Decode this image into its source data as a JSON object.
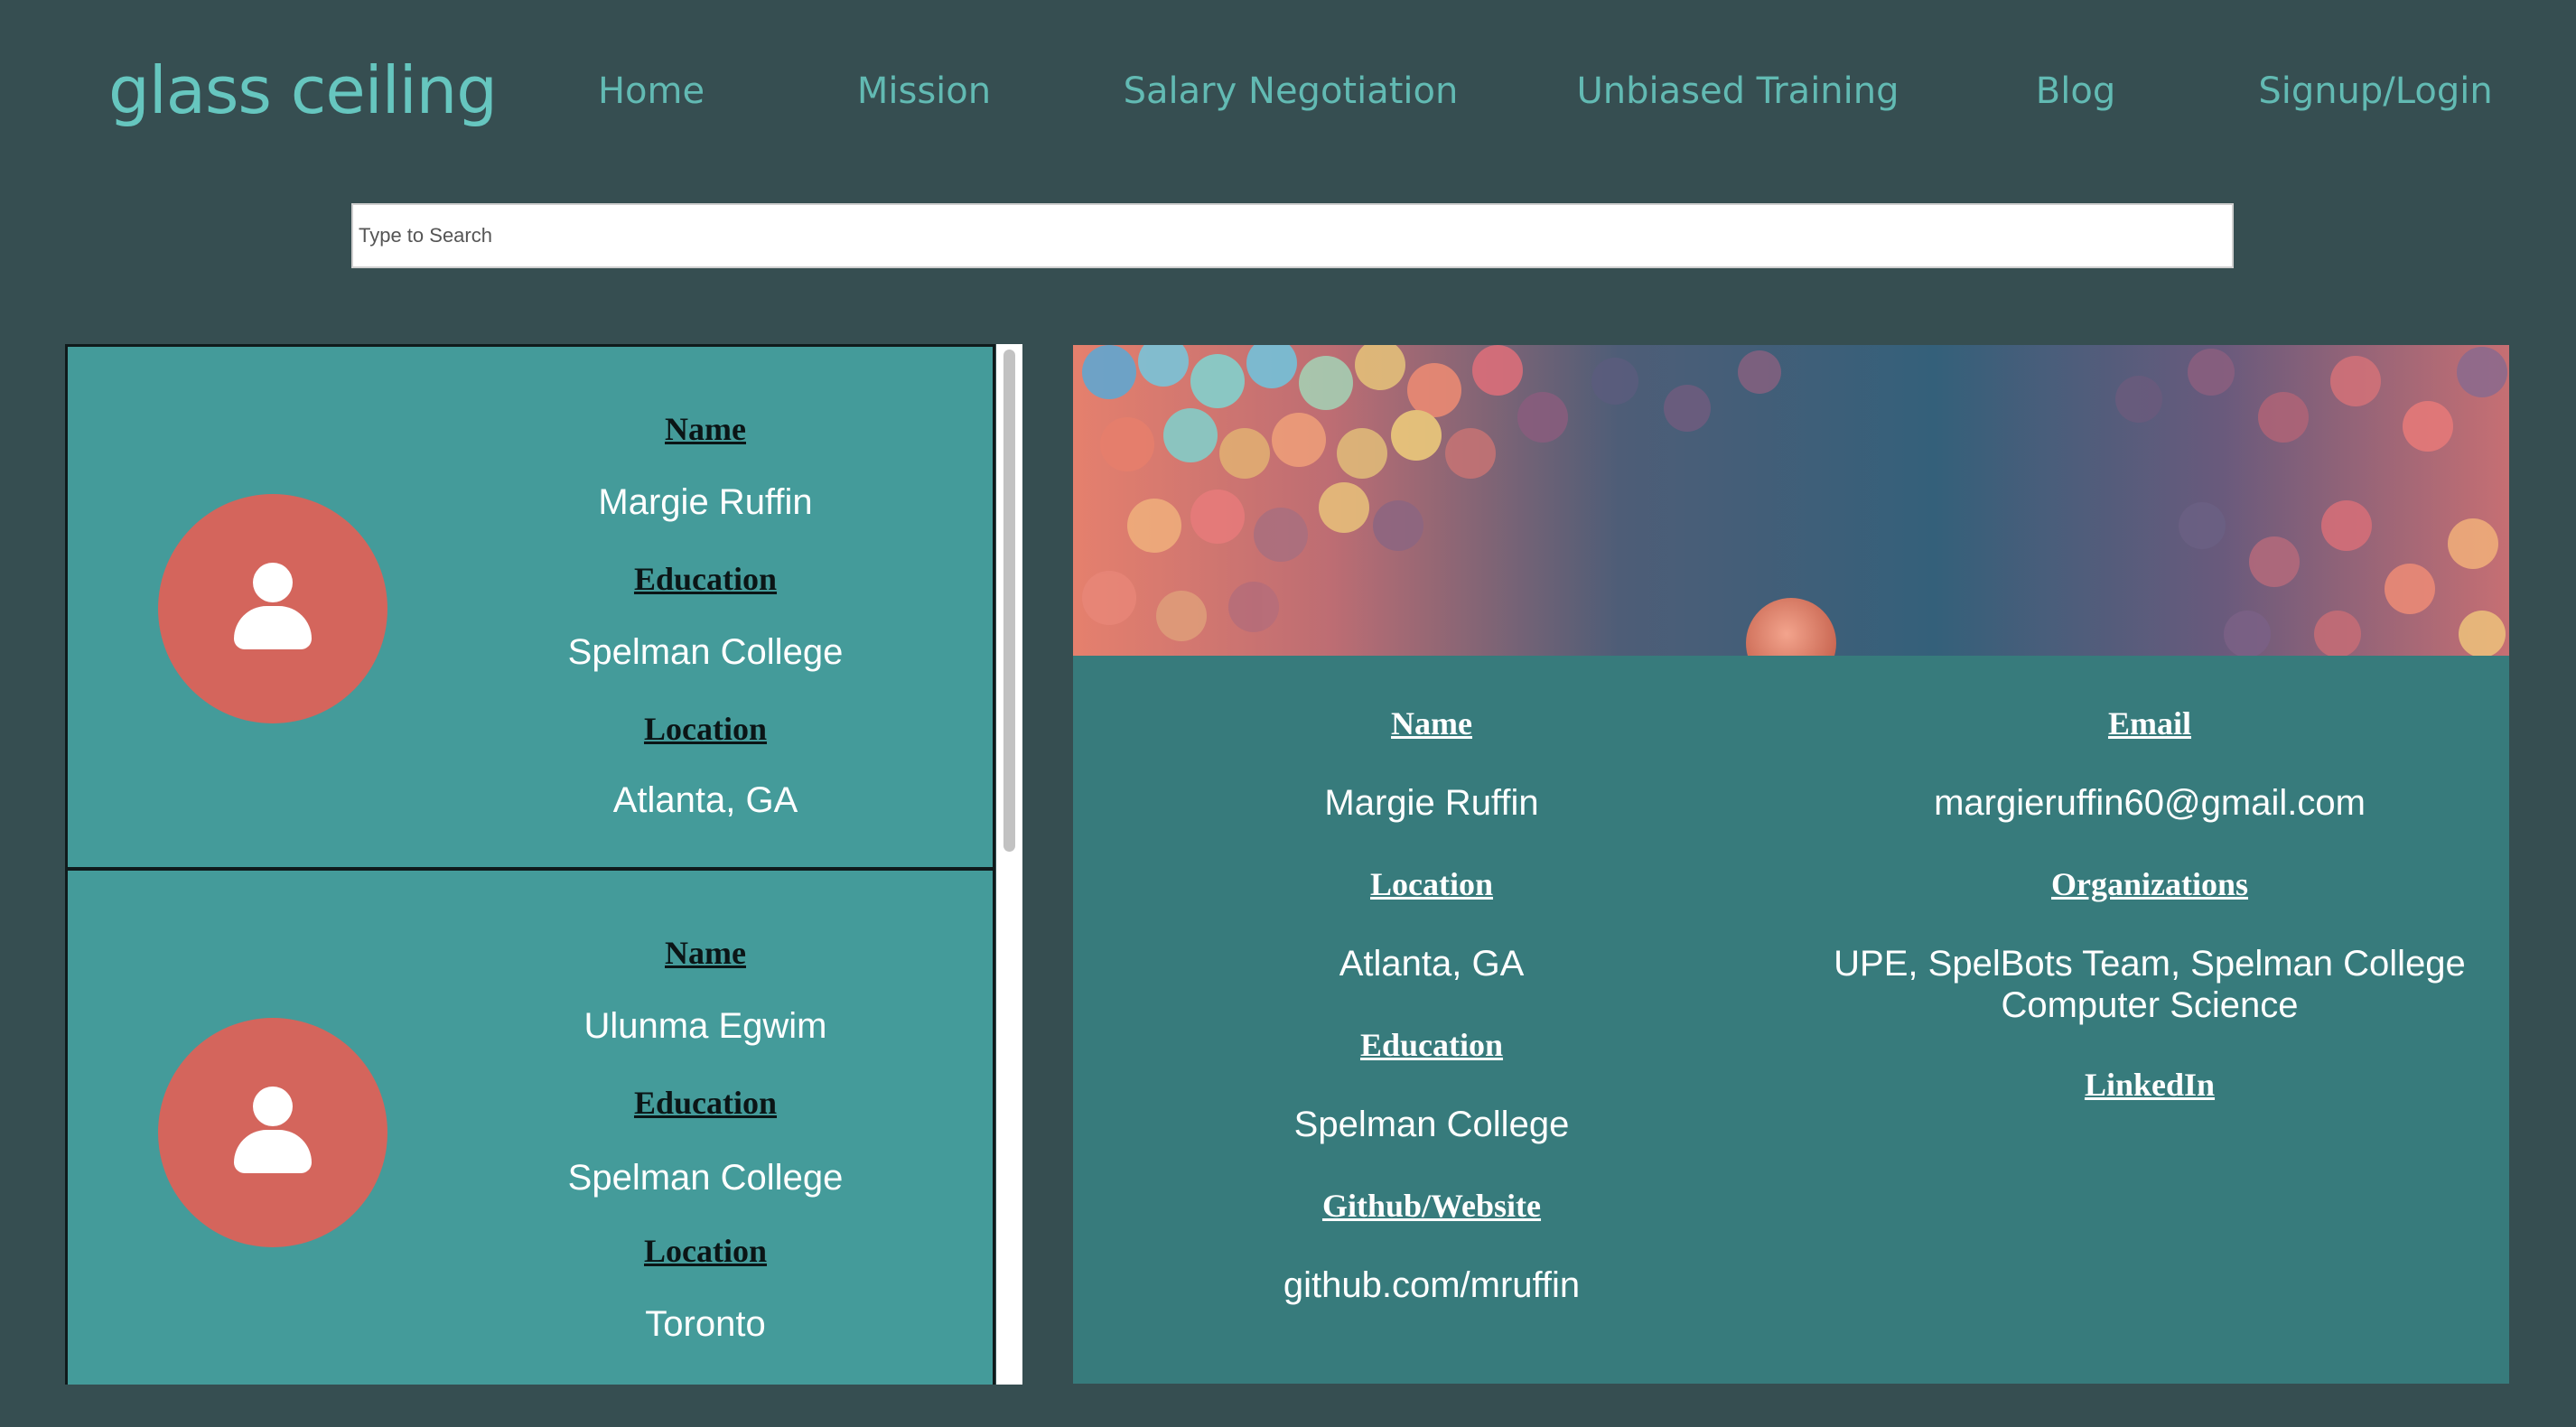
{
  "nav": {
    "logo": "glass ceiling",
    "links": [
      "Home",
      "Mission",
      "Salary Negotiation",
      "Unbiased Training",
      "Blog",
      "Signup/Login"
    ]
  },
  "search": {
    "placeholder": "Type to Search",
    "value": ""
  },
  "cards": [
    {
      "name_label": "Name",
      "name": "Margie Ruffin",
      "education_label": "Education",
      "education": "Spelman College",
      "location_label": "Location",
      "location": "Atlanta, GA",
      "avatar_icon": "person-icon"
    },
    {
      "name_label": "Name",
      "name": "Ulunma Egwim",
      "education_label": "Education",
      "education": "Spelman College",
      "location_label": "Location",
      "location": "Toronto",
      "avatar_icon": "person-icon"
    }
  ],
  "detail": {
    "name_label": "Name",
    "name": "Margie Ruffin",
    "location_label": "Location",
    "location": "Atlanta, GA",
    "education_label": "Education",
    "education": "Spelman College",
    "github_label": "Github/Website",
    "github": "github.com/mruffin",
    "email_label": "Email",
    "email": "margieruffin60@gmail.com",
    "organizations_label": "Organizations",
    "organizations": "UPE, SpelBots Team, Spelman College Computer Science",
    "linkedin_label": "LinkedIn"
  },
  "colors": {
    "page_background": "#364e51",
    "nav_text": "#62bab3",
    "logo_text": "#66c6bf",
    "card_background": "#449b9a",
    "detail_background": "#377b7c",
    "avatar": "#d4655c"
  }
}
